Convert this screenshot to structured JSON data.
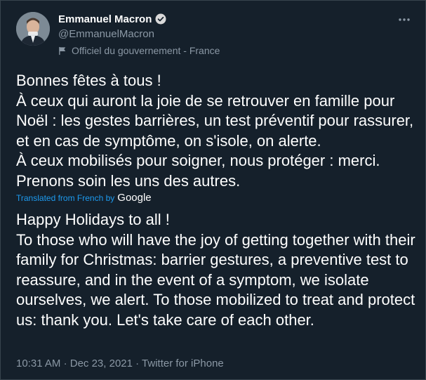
{
  "author": {
    "name": "Emmanuel Macron",
    "handle": "@EmmanuelMacron",
    "affiliation": "Officiel du gouvernement - France"
  },
  "tweet": {
    "text_original": "Bonnes fêtes à tous !\nÀ ceux qui auront la joie de se retrouver en famille pour Noël : les gestes barrières, un test préventif pour rassurer, et en cas de symptôme, on s'isole, on alerte.\nÀ ceux mobilisés pour soigner, nous protéger : merci.\nPrenons soin les uns des autres.",
    "translated_label": "Translated from French by",
    "translator": "Google",
    "text_translated": "Happy Holidays to all !\n To those who will have the joy of getting together with their family for Christmas: barrier gestures, a preventive test to reassure, and in the event of a symptom, we isolate ourselves, we alert. To those mobilized to treat and protect us: thank you. Let's take care of each other.",
    "time": "10:31 AM",
    "date": "Dec 23, 2021",
    "source": "Twitter for iPhone",
    "separator": "·"
  },
  "icons": {
    "verified": "verified-badge-icon",
    "affiliation": "flag-icon",
    "more": "more-options-icon"
  },
  "colors": {
    "background": "#15202b",
    "text": "#ffffff",
    "secondary": "#8b98a5",
    "accent": "#1d9bf0"
  }
}
